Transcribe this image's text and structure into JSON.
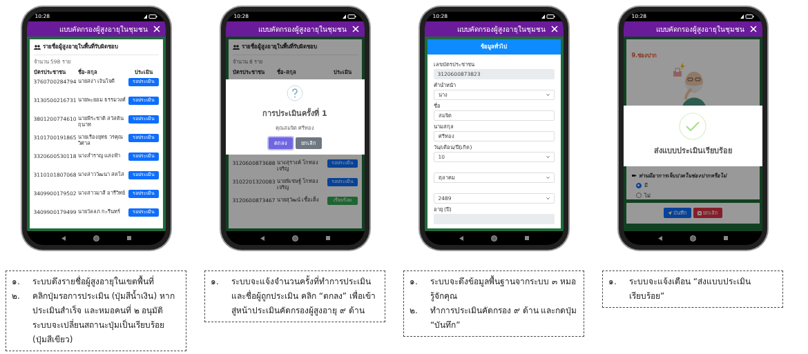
{
  "screens": [
    {
      "kind": "list",
      "status_time": "10:28",
      "title": "แบบคัดกรองผู้สูงอายุในชุมชน",
      "card_title": "รายชื่อผู้สูงอายุในพื้นที่รับผิดชอบ",
      "count": "จำนวน 598 ราย",
      "columns": [
        "บัตรประชาชน",
        "ชื่อ-สกุล",
        "ประเมิน"
      ],
      "rows": [
        {
          "id": "3760700284794",
          "name": "นายสง่า เงินใจดี",
          "action": "รอประเมิน",
          "kind": "pending"
        },
        {
          "id": "3130500216731",
          "name": "นายพะยอม ธรรมวงศ์",
          "action": "รอประเมิน",
          "kind": "pending"
        },
        {
          "id": "3801200774610",
          "name": "นายพีระชาติ สวัสดินฤนาท",
          "action": "รอประเมิน",
          "kind": "pending"
        },
        {
          "id": "3101700191865",
          "name": "นายเรืองยุทธ วรคุณวิศาล",
          "action": "รอประเมิน",
          "kind": "pending"
        },
        {
          "id": "3320600530118",
          "name": "นางสำราญ แสงฟ้า",
          "action": "รอประเมิน",
          "kind": "pending"
        },
        {
          "id": "3110101807068",
          "name": "นางสาววัฒนา สดใส",
          "action": "รอประเมิน",
          "kind": "pending"
        },
        {
          "id": "3409900179502",
          "name": "นางสาวมาลี อารีวิทย์",
          "action": "รอประเมิน",
          "kind": "pending"
        },
        {
          "id": "3409900179499",
          "name": "นายวัลลภ กะรีนทร์",
          "action": "รอประเมิน",
          "kind": "pending"
        }
      ]
    },
    {
      "kind": "list",
      "status_time": "10:28",
      "title": "แบบคัดกรองผู้สูงอายุในชุมชน",
      "card_title": "รายชื่อผู้สูงอายุในพื้นที่รับผิดชอบ",
      "count": "จำนวน 8 ราย",
      "columns": [
        "บัตรประชาชน",
        "ชื่อ-สกุล",
        "ประเมิน"
      ],
      "rows": [
        {
          "id": "3120600873688",
          "name": "นางสุรางค์ โกทองเจริญ",
          "action": "รอประเมิน",
          "kind": "pending"
        },
        {
          "id": "3102201320083",
          "name": "นายพิเชษฐ์ โกทองเจริญ",
          "action": "รอประเมิน",
          "kind": "pending"
        },
        {
          "id": "3120600873467",
          "name": "นายสุวัฒน์ เชื้อเต็ง",
          "action": "เรียบร้อย",
          "kind": "done"
        }
      ],
      "dialog": {
        "title": "การประเมินครั้งที่ 1",
        "subtitle": "คุณสมจิต ศรีทอง",
        "buttons": [
          {
            "label": "ตกลง",
            "kind": "primary"
          },
          {
            "label": "ยกเลิก",
            "kind": "secondary"
          }
        ]
      }
    },
    {
      "kind": "form",
      "status_time": "10:28",
      "title": "แบบคัดกรองผู้สูงอายุในชุมชน",
      "section_title": "ข้อมูลทั่วไป",
      "fields": [
        {
          "label": "เลขบัตรประชาชน",
          "value": "3120600873823",
          "kind": "readonly"
        },
        {
          "label": "คำนำหน้า",
          "value": "นาง",
          "kind": "select"
        },
        {
          "label": "ชื่อ",
          "value": "สมจิต",
          "kind": "text"
        },
        {
          "label": "นามสกุล",
          "value": "ศรีทอง",
          "kind": "text"
        },
        {
          "label": "วัน/เดือน/ปี(เกิด)",
          "value": "10",
          "kind": "select"
        },
        {
          "value": "ตุลาคม",
          "kind": "select"
        },
        {
          "value": "2489",
          "kind": "select"
        },
        {
          "label": "อายุ (ปี)",
          "kind": "readonly"
        }
      ]
    },
    {
      "kind": "assessment",
      "status_time": "10:28",
      "title": "แบบคัดกรองผู้สูงอายุในชุมชน",
      "heading": "9.ช่องปาก",
      "question": "ท่านมีอาการเจ็บปวดในช่องปากหรือไม่",
      "options": [
        {
          "label": "มี",
          "selected": true
        },
        {
          "label": "ไม่",
          "selected": false
        }
      ],
      "buttons": [
        {
          "label": "บันทึก",
          "kind": "save"
        },
        {
          "label": "ยกเลิก",
          "kind": "cancel"
        }
      ],
      "dialog": {
        "title": "ส่งแบบประเมินเรียบร้อย"
      }
    }
  ],
  "captions": [
    {
      "items": [
        {
          "marker": "๑.",
          "text": "ระบบดึงรายชื่อผู้สูงอายุในเขตพื้นที่"
        },
        {
          "marker": "๒.",
          "text": "คลิกปุ่มรอการประเมิน (ปุ่มสีน้ำเงิน) หากประเมินสำเร็จ และหมอคนที่ ๒ อนุมัติ ระบบจะเปลี่ยนสถานะปุ่มเป็นเรียบร้อย (ปุ่มสีเขียว)"
        }
      ]
    },
    {
      "items": [
        {
          "marker": "๑.",
          "text": "ระบบจะแจ้งจำนวนครั้งที่ทำการประเมิน และชื่อผู้ถูกประเมิน คลิก “ตกลง” เพื่อเข้าสู่หน้าประเมินคัดกรองผู้สูงอายุ ๙ ด้าน"
        }
      ]
    },
    {
      "items": [
        {
          "marker": "๑.",
          "text": "ระบบจะดึงข้อมูลพื้นฐานจากระบบ ๓ หมอรู้จักคุณ"
        },
        {
          "marker": "๒.",
          "text": "ทำการประเมินคัดกรอง ๙ ด้าน และกดปุ่ม “บันทึก”"
        }
      ]
    },
    {
      "items": [
        {
          "marker": "๑.",
          "text": "ระบบจะแจ้งเตือน “ส่งแบบประเมินเรียบร้อย”"
        }
      ]
    }
  ]
}
